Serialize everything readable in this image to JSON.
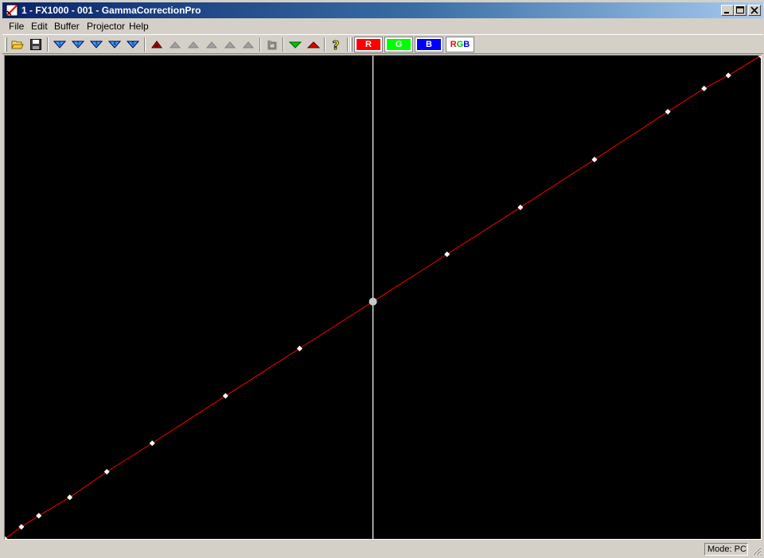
{
  "window": {
    "title": "1 - FX1000 - 001 - GammaCorrectionPro",
    "icons": [
      "app-icon",
      "minimize-icon",
      "maximize-icon",
      "close-icon"
    ]
  },
  "menu": {
    "items": [
      "File",
      "Edit",
      "Buffer",
      "Projector",
      "Help"
    ]
  },
  "toolbar": {
    "icons": [
      "open-folder-icon",
      "save-icon",
      "blue-down-arrow-1-icon",
      "blue-down-arrow-2-icon",
      "blue-down-arrow-3-icon",
      "blue-down-arrow-4-icon",
      "blue-down-arrow-5-icon",
      "red-up-icon",
      "gray-up-icon",
      "undo-icon",
      "green-down-triangle-icon",
      "red-up-triangle-icon",
      "help-icon"
    ],
    "channels": {
      "r": "R",
      "g": "G",
      "b": "B",
      "rgb_r": "R",
      "rgb_g": "G",
      "rgb_b": "B"
    },
    "colors": {
      "red": "#ff0000",
      "green": "#00ff00",
      "blue": "#0000ff"
    }
  },
  "curve": {
    "line_color": "#ff0000",
    "point_color": "#ffffff",
    "cursor_color": "#ffffff",
    "background": "#000000",
    "points": [
      [
        0.0,
        0.0
      ],
      [
        0.022,
        0.025
      ],
      [
        0.045,
        0.048
      ],
      [
        0.086,
        0.086
      ],
      [
        0.135,
        0.139
      ],
      [
        0.195,
        0.198
      ],
      [
        0.292,
        0.296
      ],
      [
        0.39,
        0.394
      ],
      [
        0.487,
        0.491
      ],
      [
        0.585,
        0.589
      ],
      [
        0.682,
        0.686
      ],
      [
        0.78,
        0.785
      ],
      [
        0.877,
        0.884
      ],
      [
        0.925,
        0.932
      ],
      [
        0.957,
        0.959
      ],
      [
        1.0,
        1.0
      ]
    ],
    "selected_point": [
      0.487,
      0.491
    ],
    "cursor_x": 0.487
  },
  "status": {
    "mode": "Mode: PC"
  }
}
